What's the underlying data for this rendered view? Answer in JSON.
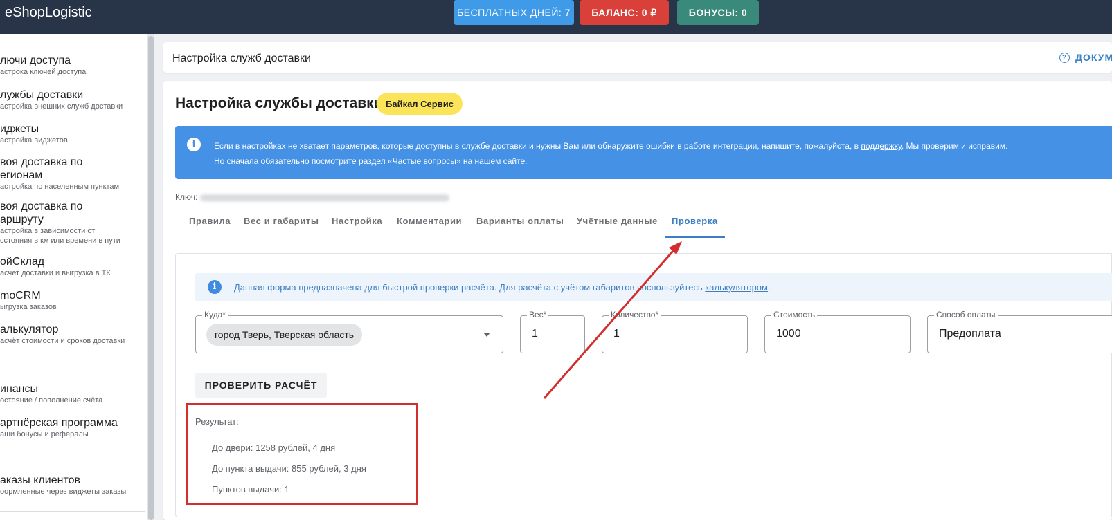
{
  "app": {
    "brand": "eShopLogistic"
  },
  "topbar": {
    "free_days": "БЕСПЛАТНЫХ ДНЕЙ: 7",
    "balance": "БАЛАНС: 0 ₽",
    "bonuses": "БОНУСЫ: 0"
  },
  "sidebar": {
    "items": [
      {
        "title": "лючи доступа",
        "sub": "астрока ключей доступа"
      },
      {
        "title": "лужбы доставки",
        "sub": "астройка внешних служб доставки"
      },
      {
        "title": "иджеты",
        "sub": "астройка виджетов"
      },
      {
        "title": "воя доставка по",
        "title2": "егионам",
        "sub": "астройка по населенным пунктам"
      },
      {
        "title": "воя доставка по",
        "title2": "аршруту",
        "sub": "астройка в зависимости от",
        "sub2": "сстояния в км или времени в пути"
      },
      {
        "title": "ойСклад",
        "sub": "асчет доставки и выгрузка в ТК"
      },
      {
        "title": "moCRM",
        "sub": "ыгрузка заказов"
      },
      {
        "title": "алькулятор",
        "sub": "асчёт стоимости и сроков доставки"
      },
      {
        "title": "инансы",
        "sub": "остояние / пополнение счёта"
      },
      {
        "title": "артнёрская программа",
        "sub": "аши бонусы и рефералы"
      },
      {
        "title": "аказы клиентов",
        "sub": "оормленные через виджеты заказы"
      }
    ]
  },
  "header": {
    "title": "Настройка служб доставки",
    "docs": "ДОКУМ"
  },
  "main": {
    "title": "Настройка службы доставки",
    "service_chip": "Байкал Сервис",
    "alert": {
      "line1_pre": "Если в настройках не хватает параметров, которые доступны в службе доставки и нужны Вам или обнаружите ошибки в работе интеграции, напишите, пожалуйста, в ",
      "line1_link": "поддержку",
      "line1_post": ". Мы проверим и исправим.",
      "line2_pre": "Но сначала обязательно посмотрите раздел «",
      "line2_link": "Частые вопросы",
      "line2_post": "» на нашем сайте."
    },
    "key_label": "Ключ:",
    "tabs": [
      "Правила",
      "Вес и габариты",
      "Настройка",
      "Комментарии",
      "Варианты оплаты",
      "Учётные данные",
      "Проверка"
    ],
    "info": {
      "text_pre": "Данная форма предназначена для быстрой проверки расчёта. Для расчёта с учётом габаритов воспользуйтесь ",
      "link": "калькулятором",
      "text_post": "."
    },
    "form": {
      "to_label": "Куда*",
      "to_value": "город Тверь, Тверская область",
      "weight_label": "Вес*",
      "weight_value": "1",
      "qty_label": "Количество*",
      "qty_value": "1",
      "cost_label": "Стоимость",
      "cost_value": "1000",
      "payment_label": "Способ оплаты",
      "payment_value": "Предоплата"
    },
    "check_button": "ПРОВЕРИТЬ РАСЧЁТ",
    "result": {
      "title": "Результат:",
      "door": "До двери: 1258 рублей, 4 дня",
      "pickup": "До пункта выдачи: 855 рублей, 3 дня",
      "points": "Пунктов выдачи: 1"
    }
  }
}
